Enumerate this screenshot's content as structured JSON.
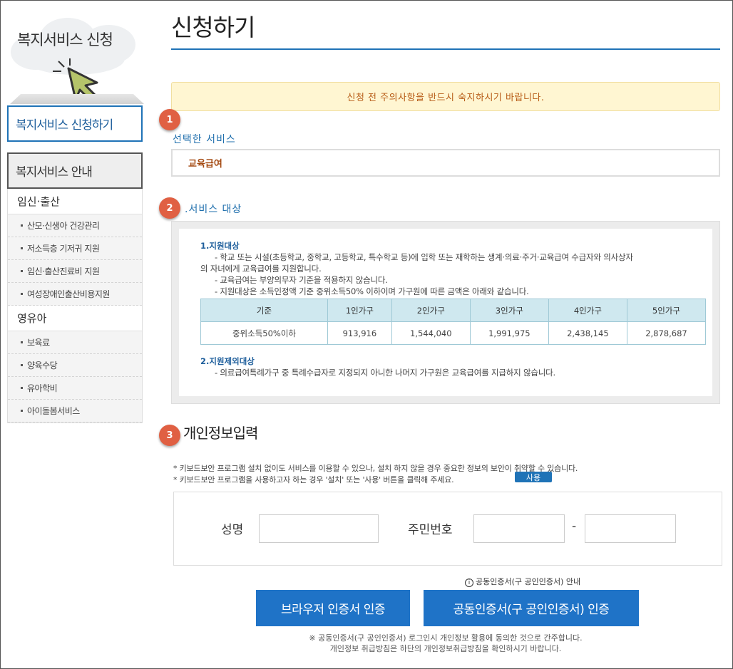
{
  "sidebar": {
    "title": "복지서비스 신청",
    "apply": "복지서비스 신청하기",
    "guide": "복지서비스 안내",
    "categories": [
      {
        "label": "임신·출산",
        "items": [
          "산모·신생아 건강관리",
          "저소득층 기저귀 지원",
          "임신·출산진료비 지원",
          "여성장애인출산비용지원"
        ]
      },
      {
        "label": "영유아",
        "items": [
          "보육료",
          "양육수당",
          "유아학비",
          "아이돌봄서비스"
        ]
      }
    ]
  },
  "page": {
    "title": "신청하기"
  },
  "notice": "신청 전 주의사항을 반드시 숙지하시기 바랍니다.",
  "steps": {
    "one": "1",
    "two": "2",
    "three": "3"
  },
  "selected_service": {
    "label": "선택한 서비스",
    "value": "교육급여"
  },
  "service_target": {
    "label": ".서비스 대상",
    "section1_title": "1.지원대상",
    "section1_lines": [
      "- 학교 또는 시설(초등학교, 중학교, 고등학교, 특수학교 등)에 입학 또는 재학하는 생계·의료·주거·교육급여 수급자와 의사상자",
      "의 자녀에게 교육급여를 지원합니다.",
      "- 교육급여는 부양의무자 기준을 적용하지 않습니다.",
      "- 지원대상은 소득인정액 기준 중위소득50% 이하이며 가구원에 따른 금액은 아래와 같습니다."
    ],
    "table": {
      "headers": [
        "기준",
        "1인가구",
        "2인가구",
        "3인가구",
        "4인가구",
        "5인가구"
      ],
      "row": [
        "중위소득50%이하",
        "913,916",
        "1,544,040",
        "1,991,975",
        "2,438,145",
        "2,878,687"
      ]
    },
    "section2_title": "2.지원제외대상",
    "section2_line": "- 의료급여특례가구 중 특례수급자로 지정되지 아니한 나머지 가구원은 교육급여를 지급하지 않습니다."
  },
  "personal_info": {
    "title": "개인정보입력",
    "note1": "* 키보드보안 프로그램 설치 없이도 서비스를 이용할 수 있으나, 설치 하지 않을 경우 중요한 정보의 보안이 취약할 수 있습니다.",
    "note2": "* 키보드보안 프로그램을 사용하고자 하는 경우 '설치' 또는 '사용' 버튼을 클릭해 주세요.",
    "use_button": "사용",
    "name_label": "성명",
    "name_value": "",
    "rrn_label": "주민번호",
    "rrn_front": "",
    "rrn_dash": "-",
    "rrn_back": ""
  },
  "auth": {
    "guide_mark": "i",
    "guide": "공동인증서(구 공인인증서) 안내",
    "browser_button": "브라우저 인증서 인증",
    "joint_button": "공동인증서(구 공인인증서) 인증",
    "footnote1": "※ 공동인증서(구 공인인증서) 로그인시 개인정보 활용에 동의한 것으로 간주합니다.",
    "footnote2": "개인정보 취급방침은 하단의 개인정보취급방침을 확인하시기 바랍니다."
  },
  "colors": {
    "accent": "#1f73b7",
    "badge": "#e06043",
    "notice_bg": "#fff6d2",
    "notice_text": "#b85c17",
    "table_header": "#cfe8ef"
  },
  "icons": {
    "pointer": "cursor-arrow-icon"
  }
}
